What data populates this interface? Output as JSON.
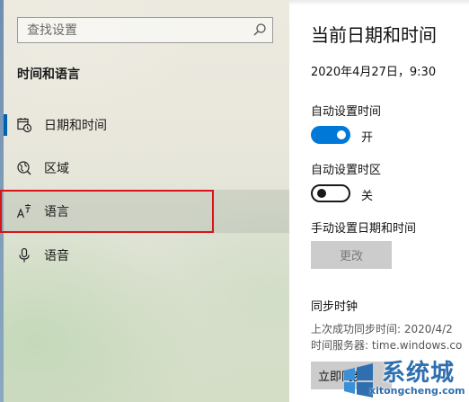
{
  "sidebar": {
    "search_placeholder": "查找设置",
    "section_title": "时间和语言",
    "items": [
      {
        "label": "日期和时间",
        "icon": "calendar-clock-icon",
        "selected": true
      },
      {
        "label": "区域",
        "icon": "globe-region-icon",
        "selected": false
      },
      {
        "label": "语言",
        "icon": "language-icon",
        "selected": false,
        "highlighted": true
      },
      {
        "label": "语音",
        "icon": "microphone-icon",
        "selected": false
      }
    ]
  },
  "main": {
    "title": "当前日期和时间",
    "current_datetime": "2020年4月27日，9:30",
    "auto_time": {
      "label": "自动设置时间",
      "state": "开",
      "on": true
    },
    "auto_timezone": {
      "label": "自动设置时区",
      "state": "关",
      "on": false
    },
    "manual_label": "手动设置日期和时间",
    "change_button": "更改",
    "sync": {
      "title": "同步时钟",
      "last_sync": "上次成功同步时间: 2020/4/2",
      "server": "时间服务器: time.windows.co",
      "button": "立即同步"
    }
  },
  "watermark": {
    "cn": "系统城",
    "en": "xitongcheng.com"
  },
  "colors": {
    "accent": "#0078d7",
    "selected_bar": "#0063b1",
    "highlight_border": "#d8141a",
    "watermark": "#2f6fb0"
  }
}
